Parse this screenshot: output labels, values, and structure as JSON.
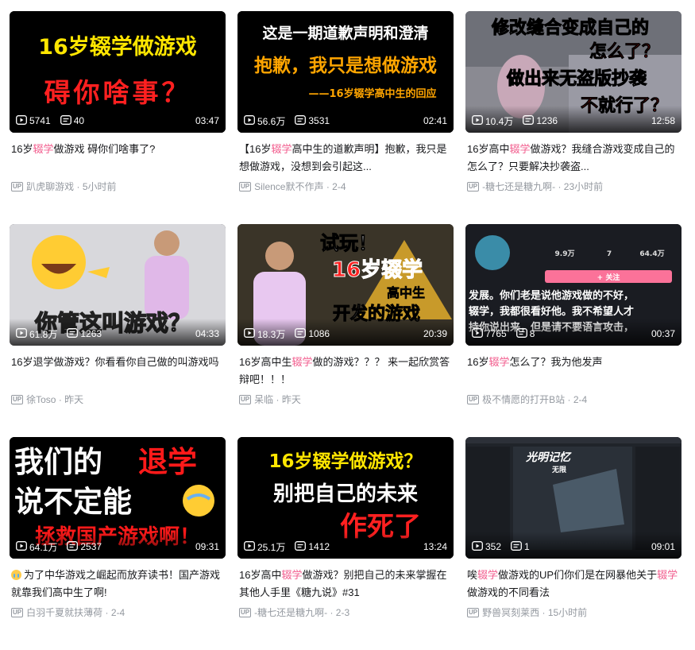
{
  "colors": {
    "highlight": "#f25d8e",
    "title": "#18191c",
    "meta": "#9499a0"
  },
  "icons": {
    "play": "play-count-icon",
    "danmaku": "danmaku-count-icon",
    "up": "up-badge-icon"
  },
  "videos": [
    {
      "thumb_text": [
        "16岁辍学做游戏",
        "碍你啥事？"
      ],
      "views": "5741",
      "danmaku": "40",
      "duration": "03:47",
      "title_parts": [
        "16岁",
        "辍学",
        "做游戏 碍你们啥事了?"
      ],
      "author": "趴虎聊游戏",
      "time": "5小时前"
    },
    {
      "thumb_text": [
        "这是一期道歉声明和澄清",
        "抱歉，我只是想做游戏",
        "——16岁辍学高中生的回应"
      ],
      "views": "56.6万",
      "danmaku": "3531",
      "duration": "02:41",
      "title_parts": [
        "【16岁",
        "辍学",
        "高中生的道歉声明】抱歉，我只是想做游戏，没想到会引起这..."
      ],
      "author": "Silence默不作声",
      "time": "2-4"
    },
    {
      "thumb_text": [
        "修改缝合变成自己的",
        "怎么了？",
        "做出来无盗版抄袭",
        "不就行了？"
      ],
      "views": "10.4万",
      "danmaku": "1236",
      "duration": "12:58",
      "title_parts": [
        "16岁高中",
        "辍学",
        "做游戏？我缝合游戏变成自己的怎么了？只要解决抄袭盗..."
      ],
      "author": "-糖七还是糖九啊-",
      "time": "23小时前"
    },
    {
      "thumb_text": [
        "你管这叫游戏？"
      ],
      "views": "61.8万",
      "danmaku": "1263",
      "duration": "04:33",
      "title_parts": [
        "16岁退学做游戏？你看看你自己做的叫游戏吗",
        "",
        ""
      ],
      "author": "徐Toso",
      "time": "昨天"
    },
    {
      "thumb_text": [
        "试玩！",
        "16岁辍学",
        "高中生",
        "开发的游戏"
      ],
      "views": "18.3万",
      "danmaku": "1086",
      "duration": "20:39",
      "title_parts": [
        "16岁高中生",
        "辍学",
        "做的游戏？？？ 来一起欣赏答辩吧！！！"
      ],
      "author": "呆临",
      "time": "昨天"
    },
    {
      "thumb_text": [
        "9.9万",
        "7",
        "64.4万",
        "发展。你们老是说他游戏做的不好，",
        "辍学，我都很看好他。我不希望人才",
        "持你说出来，但是请不要语言攻击，",
        "+ 关注"
      ],
      "views": "7765",
      "danmaku": "8",
      "duration": "00:37",
      "title_parts": [
        "16岁",
        "辍学",
        "怎么了？我为他发声"
      ],
      "author": "极不情愿的打开B站",
      "time": "2-4"
    },
    {
      "thumb_text": [
        "我们的",
        "退学",
        "说不定能",
        "拯救国产游戏啊！"
      ],
      "views": "64.1万",
      "danmaku": "2537",
      "duration": "09:31",
      "title_parts": [
        "为了中华游戏之崛起而放弃读书！国产游戏就靠我们高中生了啊!",
        "",
        ""
      ],
      "author": "白羽千夏就扶薄荷",
      "time": "2-4"
    },
    {
      "thumb_text": [
        "16岁辍学做游戏？",
        "别把自己的未来",
        "作死了"
      ],
      "views": "25.1万",
      "danmaku": "1412",
      "duration": "13:24",
      "title_parts": [
        "16岁高中",
        "辍学",
        "做游戏？别把自己的未来掌握在其他人手里《糖九说》#31"
      ],
      "author": "-糖七还是糖九啊-",
      "time": "2-3"
    },
    {
      "thumb_text": [
        "光明记忆",
        "无限"
      ],
      "views": "352",
      "danmaku": "1",
      "duration": "09:01",
      "title_parts": [
        "唉",
        "辍学",
        "做游戏的UP们你们是在网暴他关于",
        "辍学",
        "做游戏的不同看法"
      ],
      "author": "野兽冥刻莱西",
      "time": "15小时前"
    }
  ]
}
